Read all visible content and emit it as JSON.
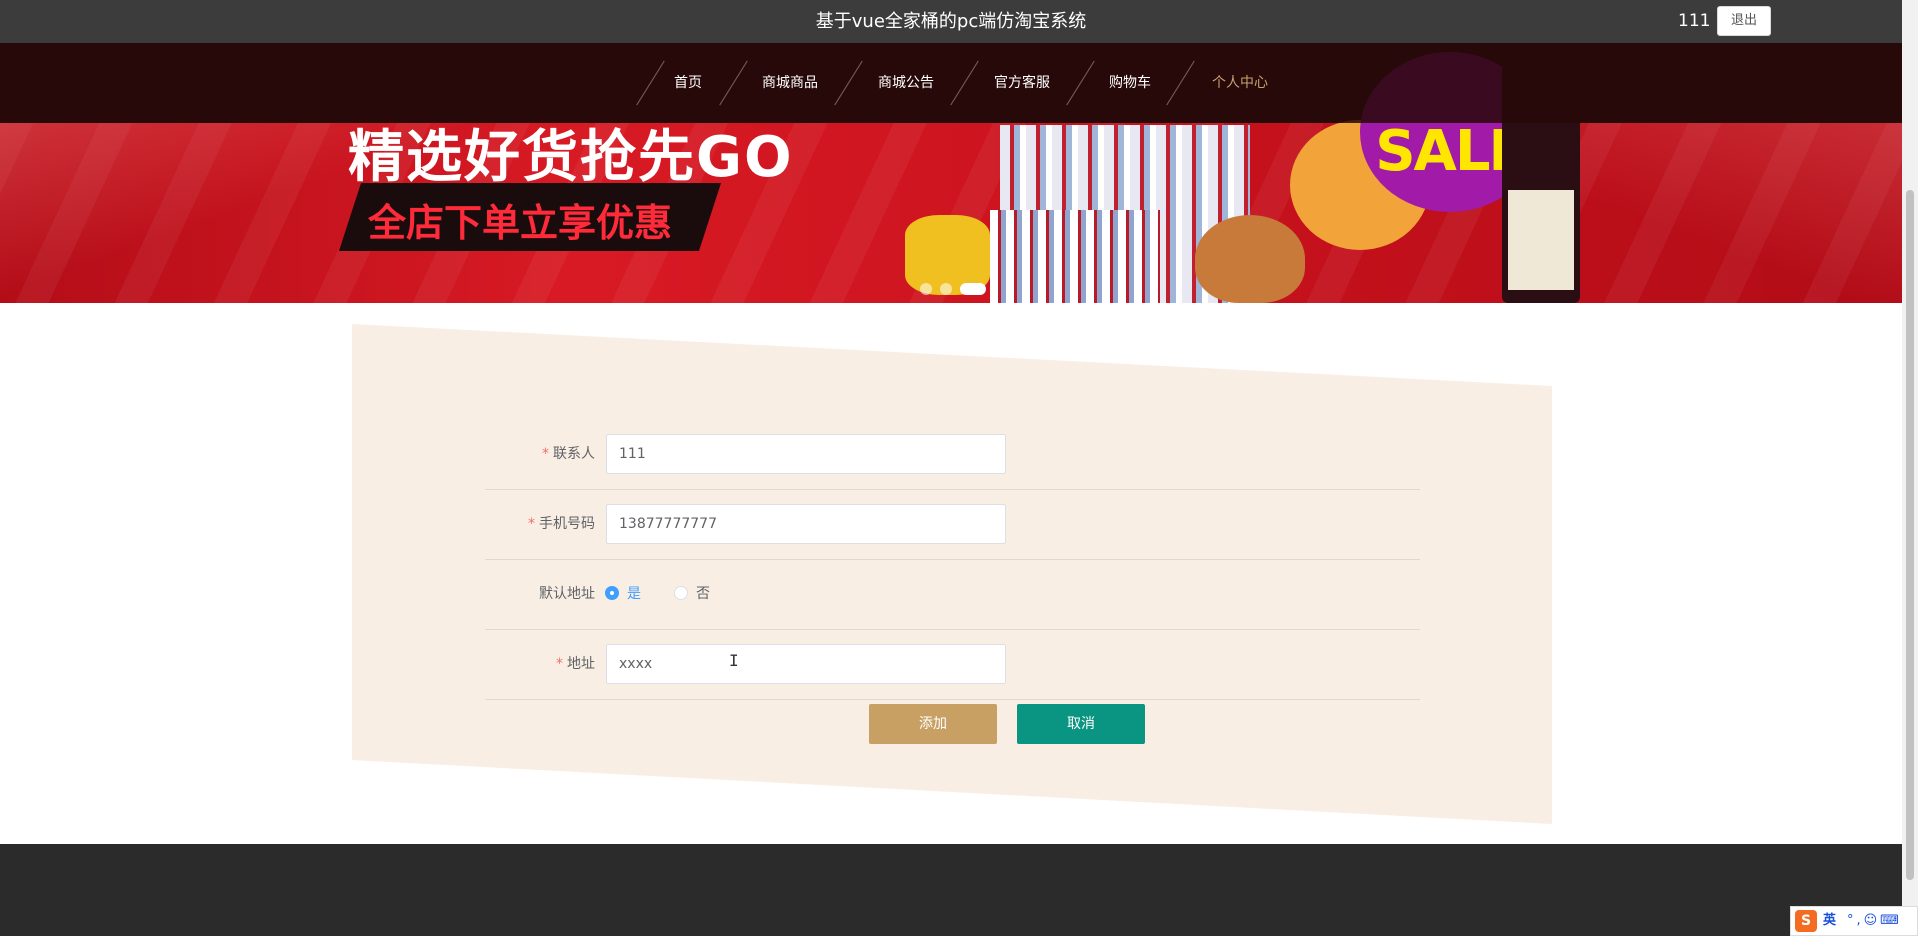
{
  "header": {
    "title": "基于vue全家桶的pc端仿淘宝系统",
    "username": "111",
    "logout_label": "退出"
  },
  "nav": {
    "items": [
      {
        "label": "首页",
        "active": false
      },
      {
        "label": "商城商品",
        "active": false
      },
      {
        "label": "商城公告",
        "active": false
      },
      {
        "label": "官方客服",
        "active": false
      },
      {
        "label": "购物车",
        "active": false
      },
      {
        "label": "个人中心",
        "active": true
      }
    ]
  },
  "banner": {
    "headline": "精选好货抢先GO",
    "subline": "全店下单立享优惠",
    "sale_text": "SALE",
    "slide_count": 3,
    "active_slide": 3
  },
  "form": {
    "contact": {
      "label": "联系人",
      "value": "111",
      "required": true
    },
    "phone": {
      "label": "手机号码",
      "value": "13877777777",
      "required": true
    },
    "default_address": {
      "label": "默认地址",
      "options": [
        {
          "label": "是",
          "checked": true
        },
        {
          "label": "否",
          "checked": false
        }
      ]
    },
    "address": {
      "label": "地址",
      "value": "xxxx",
      "required": true
    },
    "required_mark": "*",
    "add_label": "添加",
    "cancel_label": "取消"
  },
  "ime": {
    "logo": "S",
    "lang": "英",
    "icons": [
      "punctuation-icon",
      "emoji-icon",
      "keyboard-icon"
    ]
  },
  "colors": {
    "topbar": "#3c3c3c",
    "nav_active": "#c6a06d",
    "add_button": "#c8a064",
    "cancel_button": "#0a9582",
    "radio_checked": "#409eff",
    "card_bg": "#f8eee4",
    "footer": "#2b2b2b"
  }
}
